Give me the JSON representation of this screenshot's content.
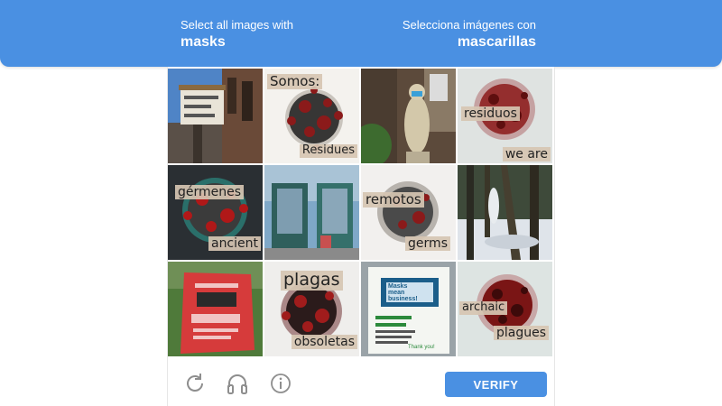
{
  "header": {
    "instruction_en": "Select all images with",
    "target_en": "masks",
    "instruction_es": "Selecciona imágenes con",
    "target_es": "mascarillas"
  },
  "tiles": [
    {
      "description": "street-theater-marquee-photo"
    },
    {
      "description": "virus-collage",
      "words": [
        "Somos:",
        "Residues"
      ]
    },
    {
      "description": "statue-wearing-mask-photo"
    },
    {
      "description": "virus-collage",
      "words": [
        "residuos",
        "we are"
      ]
    },
    {
      "description": "virus-collage",
      "words": [
        "gérmenes",
        "ancient"
      ]
    },
    {
      "description": "storefront-door-photo"
    },
    {
      "description": "virus-collage",
      "words": [
        "remotos",
        "germs"
      ]
    },
    {
      "description": "snowy-forest-photo"
    },
    {
      "description": "red-park-rules-sign-photo"
    },
    {
      "description": "virus-collage",
      "words": [
        "plagas",
        "obsoletas"
      ]
    },
    {
      "description": "masks-mean-business-sign-photo",
      "sign_text": [
        "Masks",
        "mean",
        "business!",
        "Thank you!"
      ]
    },
    {
      "description": "virus-collage",
      "words": [
        "archaic",
        "plagues"
      ]
    }
  ],
  "footer": {
    "verify_label": "VERIFY",
    "icons": [
      "refresh-icon",
      "audio-headphones-icon",
      "info-icon"
    ]
  },
  "colors": {
    "accent": "#4a90e2",
    "label_bg": "#d6c6b2",
    "virus_red": "#8b1a1a"
  }
}
